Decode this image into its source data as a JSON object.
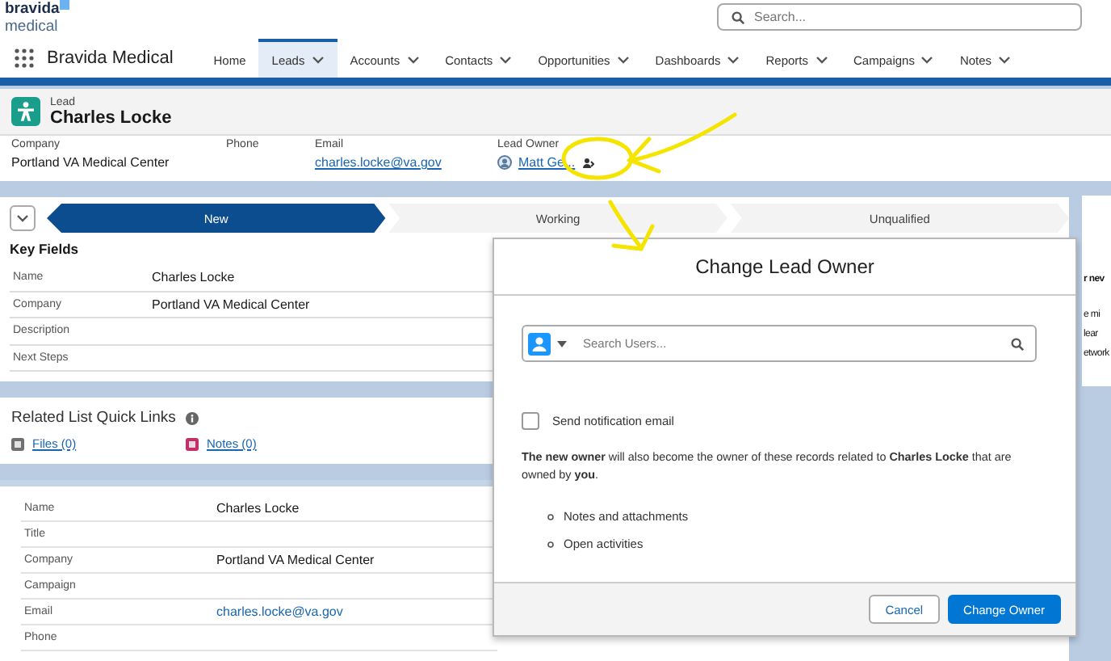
{
  "app": {
    "logo_line1": "bravida",
    "logo_line2": "medical",
    "name": "Bravida Medical",
    "search": {
      "placeholder": "Search..."
    }
  },
  "nav": [
    {
      "label": "Home",
      "selected": false,
      "has_menu": false
    },
    {
      "label": "Leads",
      "selected": true,
      "has_menu": true
    },
    {
      "label": "Accounts",
      "selected": false,
      "has_menu": true
    },
    {
      "label": "Contacts",
      "selected": false,
      "has_menu": true
    },
    {
      "label": "Opportunities",
      "selected": false,
      "has_menu": true
    },
    {
      "label": "Dashboards",
      "selected": false,
      "has_menu": true
    },
    {
      "label": "Reports",
      "selected": false,
      "has_menu": true
    },
    {
      "label": "Campaigns",
      "selected": false,
      "has_menu": true
    },
    {
      "label": "Notes",
      "selected": false,
      "has_menu": true
    }
  ],
  "record": {
    "type": "Lead",
    "name": "Charles Locke",
    "highlights": [
      {
        "label": "Company",
        "value": "Portland VA Medical Center",
        "kind": "text"
      },
      {
        "label": "Phone",
        "kind": "text"
      },
      {
        "label": "Email",
        "value": "charles.locke@va.gov",
        "kind": "link"
      },
      {
        "label": "Lead Owner",
        "value": "Matt Ge...",
        "kind": "owner"
      }
    ]
  },
  "path": {
    "stages": [
      {
        "label": "New",
        "selected": true
      },
      {
        "label": "Working",
        "selected": false
      },
      {
        "label": "Unqualified",
        "selected": false
      }
    ]
  },
  "key_fields": {
    "title": "Key Fields",
    "rows": [
      {
        "label": "Name",
        "value": "Charles Locke"
      },
      {
        "label": "Company",
        "value": "Portland VA Medical Center"
      },
      {
        "label": "Description"
      },
      {
        "label": "Next Steps"
      }
    ]
  },
  "side_fragments": [
    "r nev",
    "e mi",
    "lear",
    "etwork"
  ],
  "quick_links": {
    "title": "Related List Quick Links",
    "links": [
      {
        "label": "Files (0)",
        "color": "#707070"
      },
      {
        "label": "Notes (0)",
        "color": "#c2306a"
      }
    ]
  },
  "details": {
    "rows": [
      {
        "label": "Name",
        "value": "Charles Locke",
        "kind": "text"
      },
      {
        "label": "Title",
        "kind": "text"
      },
      {
        "label": "Company",
        "value": "Portland VA Medical Center",
        "kind": "text"
      },
      {
        "label": "Campaign",
        "kind": "text"
      },
      {
        "label": "Email",
        "value": "charles.locke@va.gov",
        "kind": "link"
      },
      {
        "label": "Phone",
        "kind": "text"
      }
    ]
  },
  "modal": {
    "title": "Change Lead Owner",
    "search": {
      "placeholder": "Search Users..."
    },
    "notify": {
      "label": "Send notification email",
      "checked": false
    },
    "message": "**The new owner** will also become the owner of these records related to **Charles Locke** that are owned by **you**.",
    "items": [
      "Notes and attachments",
      "Open activities"
    ],
    "buttons": [
      {
        "label": "Cancel",
        "kind": "neutral"
      },
      {
        "label": "Change Owner",
        "kind": "brand"
      }
    ]
  }
}
